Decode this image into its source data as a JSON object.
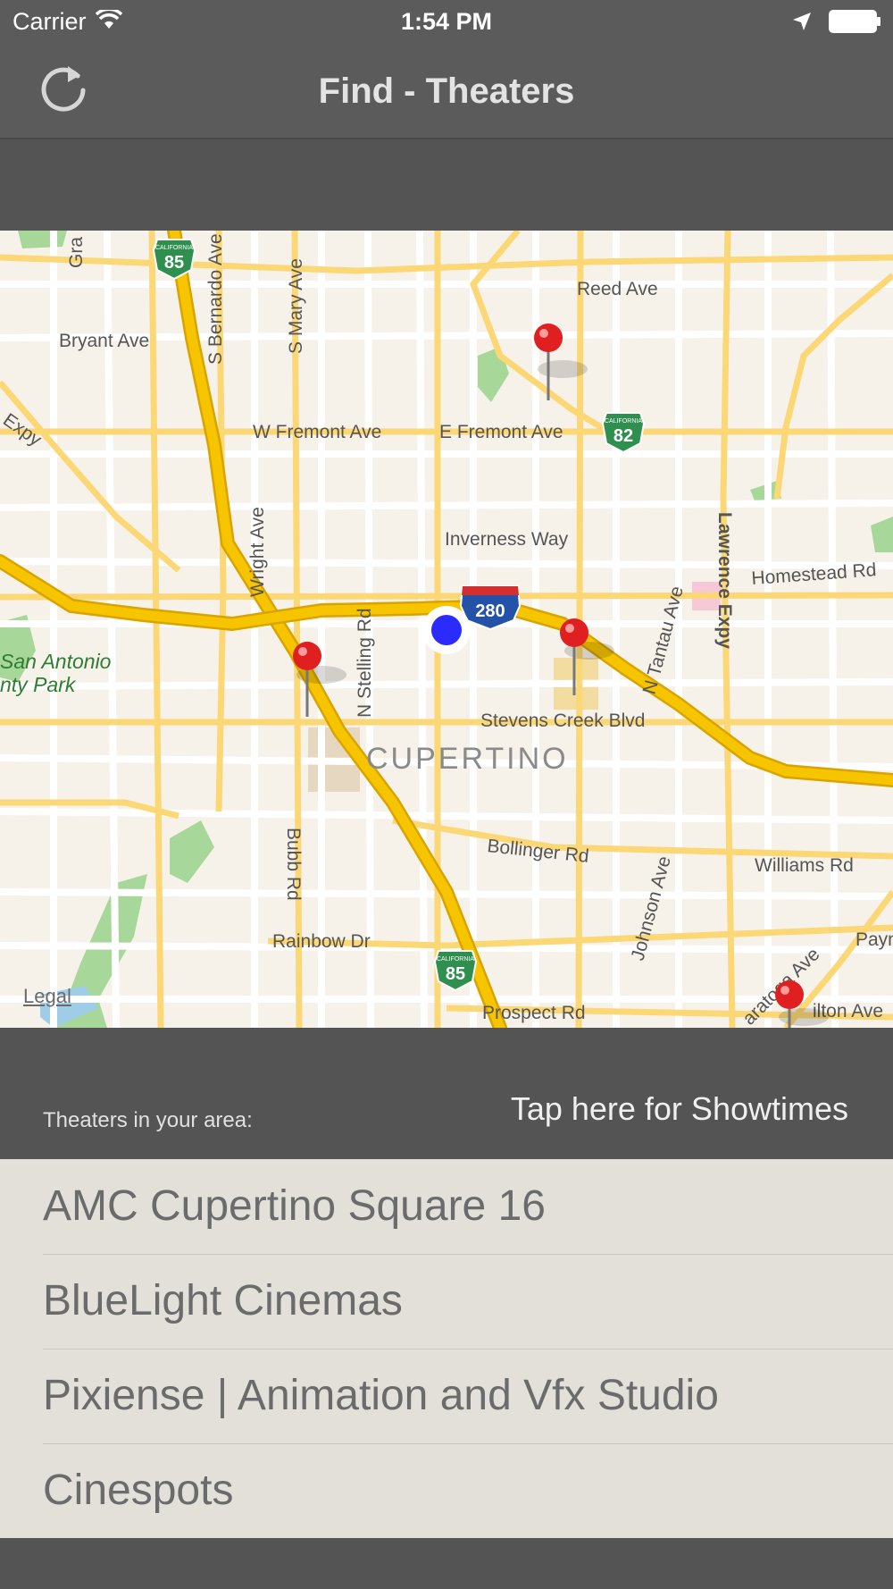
{
  "status_bar": {
    "carrier": "Carrier",
    "time": "1:54 PM"
  },
  "nav": {
    "title": "Find - Theaters"
  },
  "map": {
    "legal_label": "Legal",
    "city_label": "CUPERTINO",
    "park_label_line1": "San Antonio",
    "park_label_line2": "nty Park",
    "streets": {
      "reed_ave": "Reed Ave",
      "bryant_ave": "Bryant Ave",
      "s_bernardo_ave": "S Bernardo Ave",
      "s_mary_ave": "S Mary Ave",
      "gra": "Gra",
      "w_fremont_ave": "W Fremont Ave",
      "e_fremont_ave": "E Fremont Ave",
      "expy": "Expy",
      "inverness_way": "Inverness Way",
      "homestead_rd": "Homestead Rd",
      "wright_ave": "Wright Ave",
      "n_stelling_rd": "N Stelling Rd",
      "n_tantau_ave": "N Tantau Ave",
      "lawrence_expy": "Lawrence Expy",
      "stevens_creek_blvd": "Stevens Creek Blvd",
      "bollinger_rd": "Bollinger Rd",
      "williams_rd": "Williams Rd",
      "bubb_rd": "Bubb Rd",
      "rainbow_dr": "Rainbow Dr",
      "johnson_ave": "Johnson Ave",
      "prospect_rd": "Prospect Rd",
      "saratoga_ave": "aratoga Ave",
      "payn": "Payn",
      "hilton_ave": "ilton Ave"
    },
    "shields": {
      "ca85_top": "85",
      "ca82": "82",
      "i280": "280",
      "ca85_bottom": "85",
      "california": "CALIFORNIA"
    },
    "colors": {
      "background": "#f6f2ea",
      "freeway": "#f7c400",
      "freeway_casing": "#d9a400",
      "arterial": "#fbd775",
      "street": "#ffffff",
      "park": "#a8d79a",
      "pin": "#e02020",
      "user_location": "#2b2bff"
    }
  },
  "section": {
    "label": "Theaters in your area:",
    "showtimes_button": "Tap here for Showtimes"
  },
  "theaters": [
    "AMC Cupertino Square 16",
    "BlueLight Cinemas",
    "Pixiense | Animation and Vfx Studio",
    "Cinespots"
  ]
}
